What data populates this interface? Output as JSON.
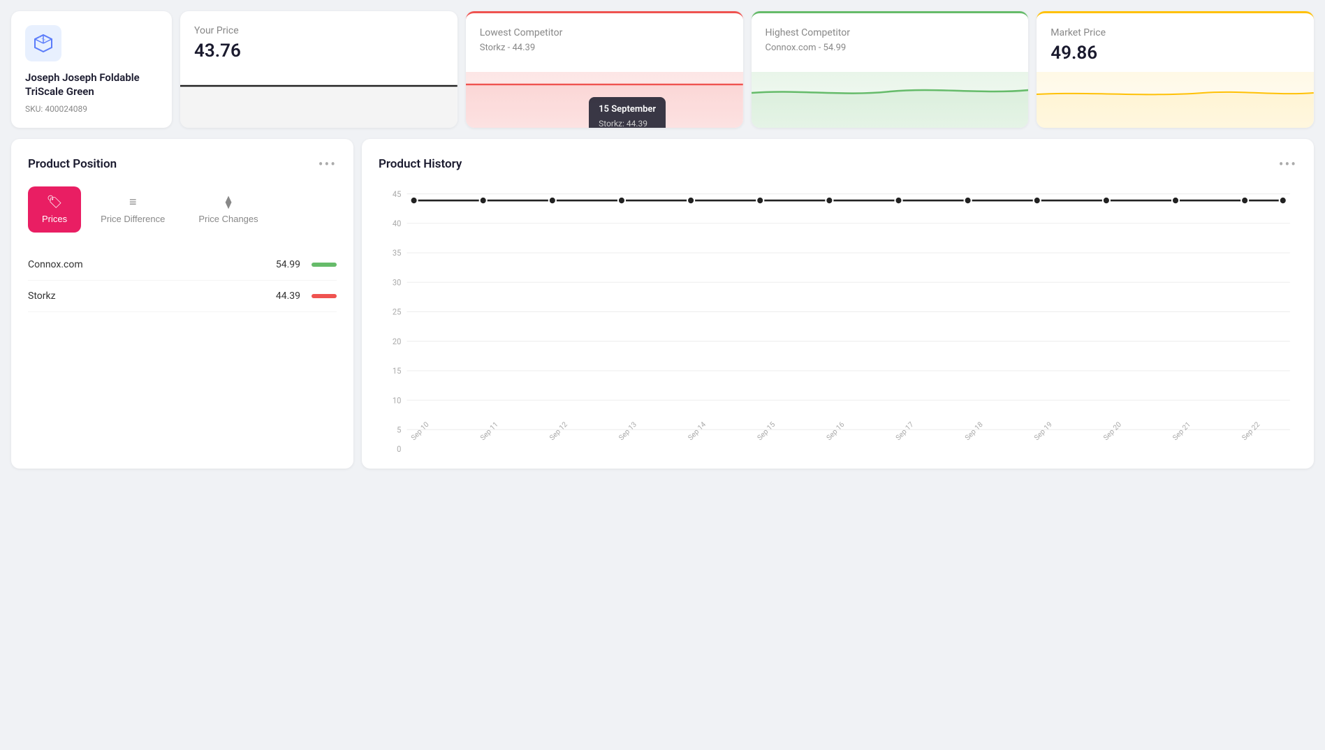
{
  "product": {
    "name": "Joseph Joseph Foldable TriScale Green",
    "sku": "SKU: 400024089"
  },
  "cards": {
    "your_price": {
      "label": "Your Price",
      "value": "43.76"
    },
    "lowest_competitor": {
      "label": "Lowest Competitor",
      "sub": "Storkz - 44.39",
      "value": "44.39"
    },
    "highest_competitor": {
      "label": "Highest Competitor",
      "sub": "Connox.com - 54.99",
      "value": "54.99"
    },
    "market_price": {
      "label": "Market Price",
      "value": "49.86"
    }
  },
  "tooltip": {
    "date": "15 September",
    "label": "Storkz: 44.39"
  },
  "product_position": {
    "title": "Product Position",
    "tabs": [
      {
        "id": "prices",
        "label": "Prices",
        "icon": "🏷"
      },
      {
        "id": "price_difference",
        "label": "Price Difference",
        "icon": "≡"
      },
      {
        "id": "price_changes",
        "label": "Price Changes",
        "icon": "⧫"
      }
    ],
    "competitors": [
      {
        "name": "Connox.com",
        "price": "54.99",
        "bar_color": "green"
      },
      {
        "name": "Storkz",
        "price": "44.39",
        "bar_color": "red"
      }
    ]
  },
  "product_history": {
    "title": "Product History",
    "y_labels": [
      "0",
      "5",
      "10",
      "15",
      "20",
      "25",
      "30",
      "35",
      "40",
      "45"
    ],
    "x_labels": [
      "Sep 10",
      "Sep 11",
      "Sep 12",
      "Sep 13",
      "Sep 14",
      "Sep 15",
      "Sep 16",
      "Sep 17",
      "Sep 18",
      "Sep 19",
      "Sep 20",
      "Sep 21",
      "Sep 22"
    ],
    "line_value": 43.76
  },
  "more_options_label": "•••",
  "colors": {
    "accent": "#e91e63",
    "green": "#66bb6a",
    "red": "#ef5350",
    "yellow": "#ffc107",
    "dark": "#1a1a2e",
    "gray": "#888"
  }
}
